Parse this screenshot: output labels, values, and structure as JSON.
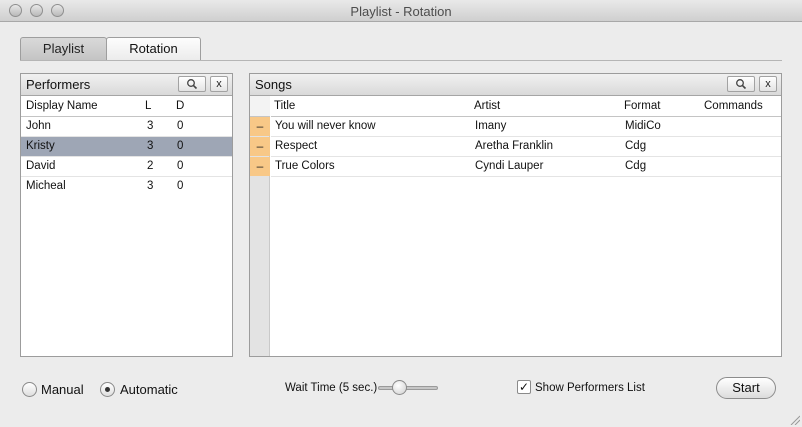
{
  "window": {
    "title": "Playlist - Rotation"
  },
  "tabs": [
    {
      "label": "Playlist"
    },
    {
      "label": "Rotation"
    }
  ],
  "performers": {
    "title": "Performers",
    "search_icon": "magnifier-icon",
    "clear_label": "x",
    "columns": {
      "name": "Display Name",
      "l": "L",
      "d": "D"
    },
    "rows": [
      {
        "name": "John",
        "l": "3",
        "d": "0"
      },
      {
        "name": "Kristy",
        "l": "3",
        "d": "0"
      },
      {
        "name": "David",
        "l": "2",
        "d": "0"
      },
      {
        "name": "Micheal",
        "l": "3",
        "d": "0"
      }
    ]
  },
  "songs": {
    "title": "Songs",
    "search_icon": "magnifier-icon",
    "clear_label": "x",
    "columns": {
      "title": "Title",
      "artist": "Artist",
      "format": "Format",
      "commands": "Commands"
    },
    "remove_label": "–",
    "rows": [
      {
        "title": "You will never know",
        "artist": "Imany",
        "format": "MidiCo"
      },
      {
        "title": "Respect",
        "artist": "Aretha Franklin",
        "format": "Cdg"
      },
      {
        "title": "True Colors",
        "artist": "Cyndi Lauper",
        "format": "Cdg"
      }
    ]
  },
  "controls": {
    "manual_label": "Manual",
    "automatic_label": "Automatic",
    "wait_label": "Wait Time (5 sec.)",
    "show_performers_label": "Show Performers List",
    "show_performers_checked": true,
    "check_mark": "✓",
    "start_label": "Start"
  }
}
